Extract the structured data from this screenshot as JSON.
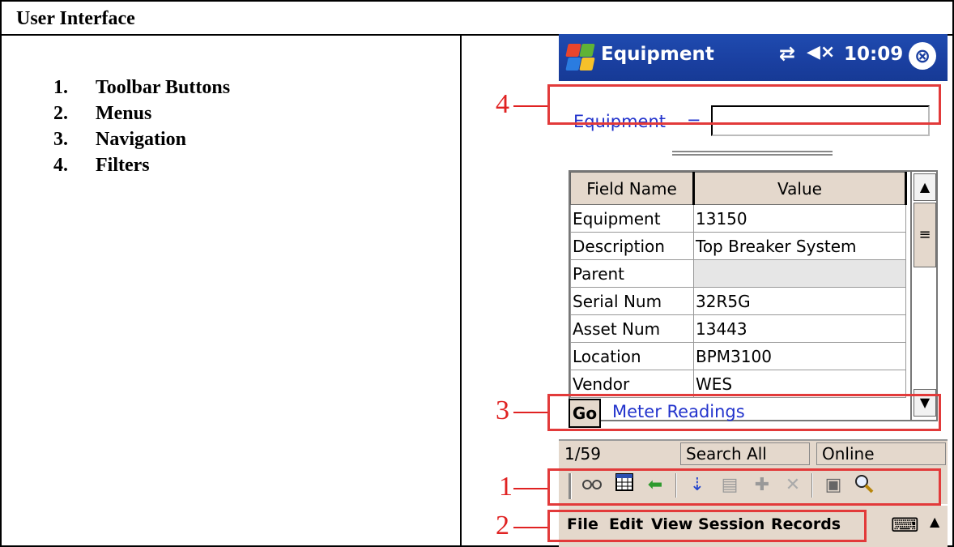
{
  "doc": {
    "header": "User Interface",
    "items": [
      {
        "num": "1.",
        "label": "Toolbar Buttons"
      },
      {
        "num": "2.",
        "label": "Menus"
      },
      {
        "num": "3.",
        "label": "Navigation"
      },
      {
        "num": "4.",
        "label": "Filters"
      }
    ]
  },
  "device": {
    "titlebar": {
      "title": "Equipment",
      "time": "10:09",
      "sync_icon": "⇄",
      "volume_icon": "◀×",
      "close_icon": "⊗"
    },
    "filter": {
      "label": "Equipment",
      "operator": "=",
      "value": ""
    },
    "grid": {
      "columns": [
        "Field Name",
        "Value"
      ],
      "rows": [
        {
          "field": "Equipment",
          "value": "13150"
        },
        {
          "field": "Description",
          "value": "Top Breaker System"
        },
        {
          "field": "Parent",
          "value": ""
        },
        {
          "field": "Serial Num",
          "value": "32R5G"
        },
        {
          "field": "Asset Num",
          "value": "13443"
        },
        {
          "field": "Location",
          "value": "BPM3100"
        },
        {
          "field": "Vendor",
          "value": "WES"
        }
      ]
    },
    "navigation": {
      "go_label": "Go",
      "link": "Meter Readings"
    },
    "status": {
      "record": "1/59",
      "search": "Search All",
      "mode": "Online"
    },
    "menu": [
      "File",
      "Edit",
      "View",
      "Session",
      "Records"
    ]
  },
  "callouts": [
    "4",
    "3",
    "1",
    "2"
  ],
  "colors": {
    "callout": "#e23a3a",
    "titlebar": "#1a3fa0",
    "link": "#2233cc",
    "chrome": "#e4d8cc"
  }
}
